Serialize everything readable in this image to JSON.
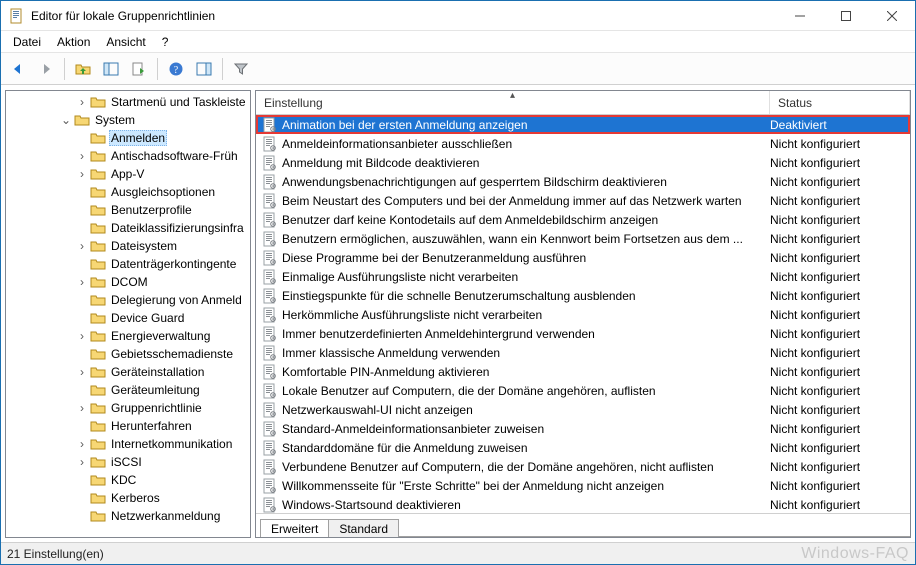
{
  "window": {
    "title": "Editor für lokale Gruppenrichtlinien"
  },
  "menu": {
    "items": [
      "Datei",
      "Aktion",
      "Ansicht",
      "?"
    ]
  },
  "toolbar_icons": [
    "back",
    "forward",
    "up",
    "show-hide-tree",
    "export-list",
    "refresh",
    "help",
    "show-hide-action",
    "filter"
  ],
  "tree": {
    "visible": [
      {
        "depth": 4,
        "label": "Startmenü und Taskleiste",
        "exp": "closed"
      },
      {
        "depth": 3,
        "label": "System",
        "exp": "open"
      },
      {
        "depth": 4,
        "label": "Anmelden",
        "exp": "leaf",
        "selected": true
      },
      {
        "depth": 4,
        "label": "Antischadsoftware-Früh",
        "exp": "closed"
      },
      {
        "depth": 4,
        "label": "App-V",
        "exp": "closed"
      },
      {
        "depth": 4,
        "label": "Ausgleichsoptionen",
        "exp": "leaf"
      },
      {
        "depth": 4,
        "label": "Benutzerprofile",
        "exp": "leaf"
      },
      {
        "depth": 4,
        "label": "Dateiklassifizierungsinfra",
        "exp": "leaf"
      },
      {
        "depth": 4,
        "label": "Dateisystem",
        "exp": "closed"
      },
      {
        "depth": 4,
        "label": "Datenträgerkontingente",
        "exp": "leaf"
      },
      {
        "depth": 4,
        "label": "DCOM",
        "exp": "closed"
      },
      {
        "depth": 4,
        "label": "Delegierung von Anmeld",
        "exp": "leaf"
      },
      {
        "depth": 4,
        "label": "Device Guard",
        "exp": "leaf"
      },
      {
        "depth": 4,
        "label": "Energieverwaltung",
        "exp": "closed"
      },
      {
        "depth": 4,
        "label": "Gebietsschemadienste",
        "exp": "leaf"
      },
      {
        "depth": 4,
        "label": "Geräteinstallation",
        "exp": "closed"
      },
      {
        "depth": 4,
        "label": "Geräteumleitung",
        "exp": "leaf"
      },
      {
        "depth": 4,
        "label": "Gruppenrichtlinie",
        "exp": "closed"
      },
      {
        "depth": 4,
        "label": "Herunterfahren",
        "exp": "leaf"
      },
      {
        "depth": 4,
        "label": "Internetkommunikation",
        "exp": "closed"
      },
      {
        "depth": 4,
        "label": "iSCSI",
        "exp": "closed"
      },
      {
        "depth": 4,
        "label": "KDC",
        "exp": "leaf"
      },
      {
        "depth": 4,
        "label": "Kerberos",
        "exp": "leaf"
      },
      {
        "depth": 4,
        "label": "Netzwerkanmeldung",
        "exp": "leaf"
      }
    ]
  },
  "list": {
    "columns": {
      "c1": "Einstellung",
      "c2": "Status"
    },
    "rows": [
      {
        "name": "Animation bei der ersten Anmeldung anzeigen",
        "status": "Deaktiviert",
        "selected": true,
        "highlight": true
      },
      {
        "name": "Anmeldeinformationsanbieter ausschließen",
        "status": "Nicht konfiguriert"
      },
      {
        "name": "Anmeldung mit Bildcode deaktivieren",
        "status": "Nicht konfiguriert"
      },
      {
        "name": "Anwendungsbenachrichtigungen auf gesperrtem Bildschirm deaktivieren",
        "status": "Nicht konfiguriert"
      },
      {
        "name": "Beim Neustart des Computers und bei der Anmeldung immer auf das Netzwerk warten",
        "status": "Nicht konfiguriert"
      },
      {
        "name": "Benutzer darf keine Kontodetails auf dem Anmeldebildschirm anzeigen",
        "status": "Nicht konfiguriert"
      },
      {
        "name": "Benutzern ermöglichen, auszuwählen, wann ein Kennwort beim Fortsetzen aus dem ...",
        "status": "Nicht konfiguriert"
      },
      {
        "name": "Diese Programme bei der Benutzeranmeldung ausführen",
        "status": "Nicht konfiguriert"
      },
      {
        "name": "Einmalige Ausführungsliste nicht verarbeiten",
        "status": "Nicht konfiguriert"
      },
      {
        "name": "Einstiegspunkte für die schnelle Benutzerumschaltung ausblenden",
        "status": "Nicht konfiguriert"
      },
      {
        "name": "Herkömmliche Ausführungsliste nicht verarbeiten",
        "status": "Nicht konfiguriert"
      },
      {
        "name": "Immer benutzerdefinierten Anmeldehintergrund verwenden",
        "status": "Nicht konfiguriert"
      },
      {
        "name": "Immer klassische Anmeldung verwenden",
        "status": "Nicht konfiguriert"
      },
      {
        "name": "Komfortable PIN-Anmeldung aktivieren",
        "status": "Nicht konfiguriert"
      },
      {
        "name": "Lokale Benutzer auf Computern, die der Domäne angehören, auflisten",
        "status": "Nicht konfiguriert"
      },
      {
        "name": "Netzwerkauswahl-UI nicht anzeigen",
        "status": "Nicht konfiguriert"
      },
      {
        "name": "Standard-Anmeldeinformationsanbieter zuweisen",
        "status": "Nicht konfiguriert"
      },
      {
        "name": "Standarddomäne für die Anmeldung zuweisen",
        "status": "Nicht konfiguriert"
      },
      {
        "name": "Verbundene Benutzer auf Computern, die der Domäne angehören, nicht auflisten",
        "status": "Nicht konfiguriert"
      },
      {
        "name": "Willkommensseite für \"Erste Schritte\" bei der Anmeldung nicht anzeigen",
        "status": "Nicht konfiguriert"
      },
      {
        "name": "Windows-Startsound deaktivieren",
        "status": "Nicht konfiguriert"
      }
    ]
  },
  "tabs": {
    "items": [
      "Erweitert",
      "Standard"
    ],
    "active": 0
  },
  "status": {
    "text": "21 Einstellung(en)"
  },
  "watermark": "Windows-FAQ"
}
